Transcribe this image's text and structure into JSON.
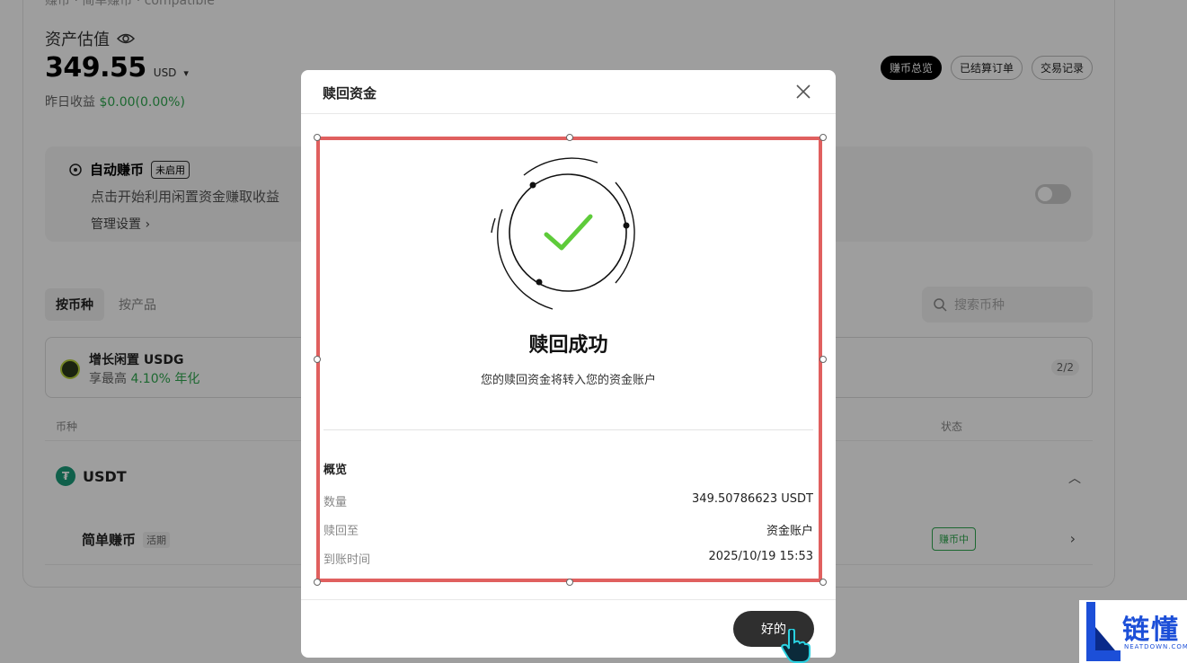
{
  "page": {
    "breadcrumb": "赚币 · 简单赚币 · compatible",
    "asset_label": "资产估值",
    "asset_value": "349.55",
    "asset_currency": "USD",
    "yesterday_label": "昨日收益",
    "yesterday_value": "$0.00(0.00%)",
    "pills": [
      "赚币总览",
      "已结算订单",
      "交易记录"
    ],
    "auto": {
      "title": "自动赚币",
      "tag": "未启用",
      "subtitle": "点击开始利用闲置资金赚取收益",
      "manage": "管理设置"
    },
    "tabs": [
      "按币种",
      "按产品"
    ],
    "search_placeholder": "搜索币种",
    "usdg": {
      "title": "增长闲置 USDG",
      "apy_prefix": "享最高",
      "apy_value": "4.10% 年化",
      "pager": "2/2"
    },
    "columns": {
      "coin": "币种",
      "status": "状态"
    },
    "usdt_label": "USDT",
    "simple": {
      "label": "简单赚币",
      "tag": "活期",
      "status": "赚币中"
    }
  },
  "modal": {
    "title": "赎回资金",
    "success_title": "赎回成功",
    "success_sub": "您的赎回资金将转入您的资金账户",
    "overview_title": "概览",
    "rows": [
      {
        "key": "数量",
        "value": "349.50786623 USDT"
      },
      {
        "key": "赎回至",
        "value": "资金账户"
      },
      {
        "key": "到账时间",
        "value": "2025/10/19 15:53"
      }
    ],
    "ok_label": "好的"
  },
  "logo": {
    "cn": "链懂",
    "en": "NEATDOWN.COM"
  },
  "colors": {
    "accent_green": "#2fa84f",
    "selection_red": "#e0605f",
    "check_green": "#5ecb3a"
  }
}
